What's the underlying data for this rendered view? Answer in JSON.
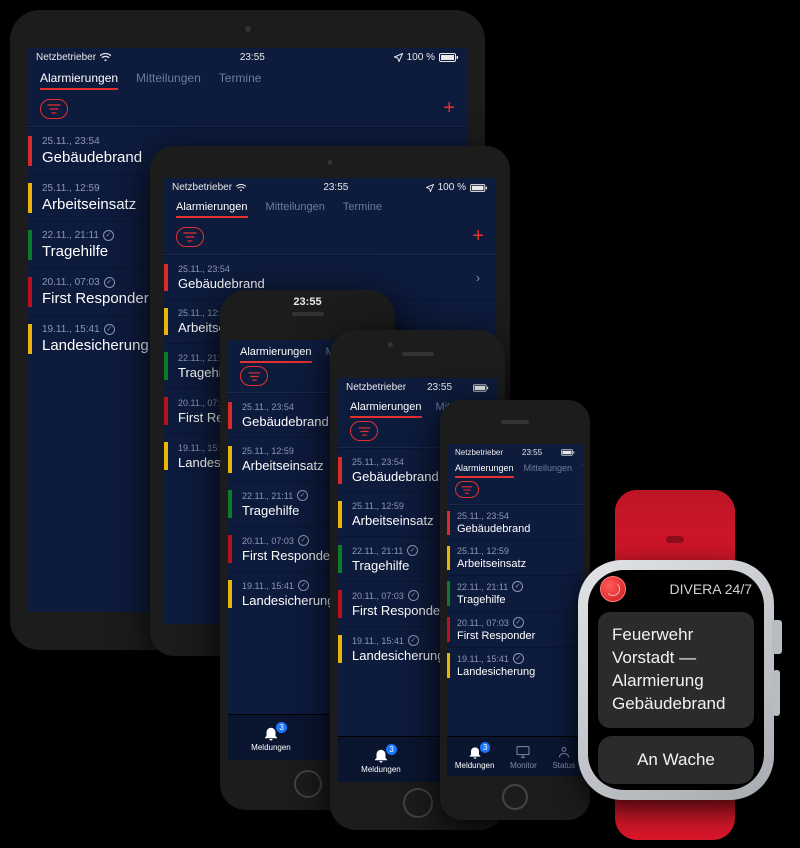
{
  "status": {
    "carrier": "Netzbetrieber",
    "time": "23:55",
    "battery": "100 %",
    "signal_icon": "wifi-icon",
    "location_icon": "location-icon"
  },
  "tabs": {
    "alarm": "Alarmierungen",
    "mitteil": "Mitteilungen",
    "termine": "Termine"
  },
  "alarms": [
    {
      "date": "25.11., 23:54",
      "title": "Gebäudebrand",
      "color": "#d92b2b",
      "checked": false
    },
    {
      "date": "25.11., 12:59",
      "title": "Arbeitseinsatz",
      "color": "#e8b50c",
      "checked": false
    },
    {
      "date": "22.11., 21:11",
      "title": "Tragehilfe",
      "color": "#0e7a2b",
      "checked": true
    },
    {
      "date": "20.11., 07:03",
      "title": "First Responder",
      "color": "#b81122",
      "checked": true
    },
    {
      "date": "19.11., 15:41",
      "title": "Landesicherung",
      "color": "#e8b50c",
      "checked": true
    }
  ],
  "bottom": {
    "meldungen": "Meldungen",
    "monitor": "Monitor",
    "status": "Status",
    "badge": "3"
  },
  "watch": {
    "app_name": "DIVERA 24/7",
    "message": "Feuerwehr Vorstadt — Alarmierung Gebäudebrand",
    "button": "An Wache"
  }
}
